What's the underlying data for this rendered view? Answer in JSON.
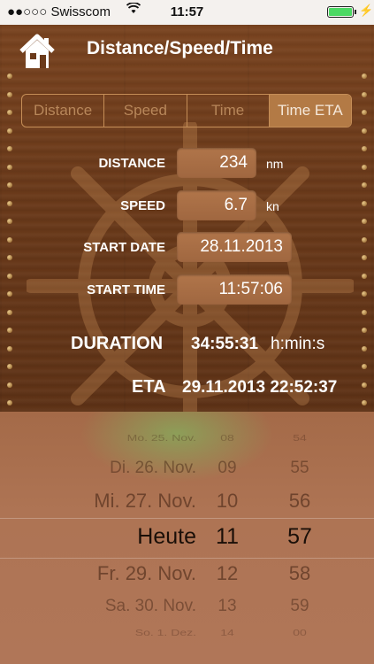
{
  "status": {
    "carrier": "●●○○○ Swisscom",
    "wifi": "wifi-icon",
    "time": "11:57",
    "battery": "battery-icon"
  },
  "header": {
    "title": "Distance/Speed/Time"
  },
  "segments": [
    {
      "label": "Distance",
      "active": false
    },
    {
      "label": "Speed",
      "active": false
    },
    {
      "label": "Time",
      "active": false
    },
    {
      "label": "Time ETA",
      "active": true
    }
  ],
  "form": {
    "distance": {
      "label": "DISTANCE",
      "value": "234",
      "unit": "nm"
    },
    "speed": {
      "label": "SPEED",
      "value": "6.7",
      "unit": "kn"
    },
    "start_date": {
      "label": "START DATE",
      "value": "28.11.2013"
    },
    "start_time": {
      "label": "START TIME",
      "value": "11:57:06"
    }
  },
  "results": {
    "duration": {
      "label": "DURATION",
      "value": "34:55:31",
      "unit": "h:min:s"
    },
    "eta": {
      "label": "ETA",
      "value": "29.11.2013 22:52:37"
    }
  },
  "picker": {
    "rows": [
      {
        "date": "Mo. 25. Nov.",
        "hour": "08",
        "minute": "54"
      },
      {
        "date": "Di. 26. Nov.",
        "hour": "09",
        "minute": "55"
      },
      {
        "date": "Mi. 27. Nov.",
        "hour": "10",
        "minute": "56"
      },
      {
        "date": "Heute",
        "hour": "11",
        "minute": "57"
      },
      {
        "date": "Fr. 29. Nov.",
        "hour": "12",
        "minute": "58"
      },
      {
        "date": "Sa. 30. Nov.",
        "hour": "13",
        "minute": "59"
      },
      {
        "date": "So. 1. Dez.",
        "hour": "14",
        "minute": "00"
      }
    ],
    "selected_index": 3
  }
}
